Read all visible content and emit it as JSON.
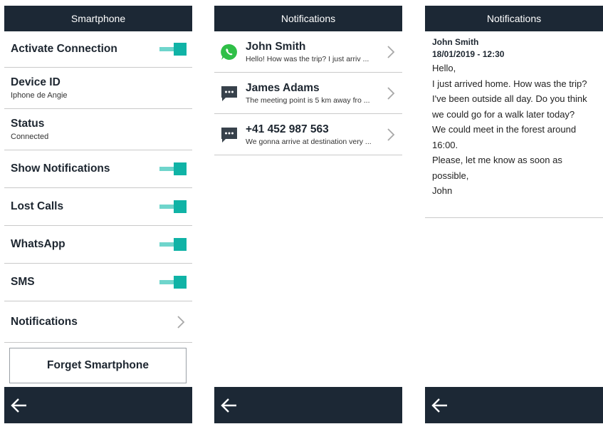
{
  "screen1": {
    "title": "Smartphone",
    "rows": [
      {
        "label": "Activate Connection",
        "control": "toggle",
        "on": true
      },
      {
        "label": "Device ID",
        "value": "Iphone de Angie"
      },
      {
        "label": "Status",
        "value": "Connected"
      },
      {
        "label": "Show Notifications",
        "control": "toggle",
        "on": true
      },
      {
        "label": "Lost Calls",
        "control": "toggle",
        "on": true
      },
      {
        "label": "WhatsApp",
        "control": "toggle",
        "on": true
      },
      {
        "label": "SMS",
        "control": "toggle",
        "on": true
      },
      {
        "label": "Notifications",
        "control": "chevron-right-icon"
      }
    ],
    "forget_button": "Forget Smartphone"
  },
  "screen2": {
    "title": "Notifications",
    "items": [
      {
        "icon": "whatsapp-icon",
        "name": "John Smith",
        "preview": "Hello! How was the trip? I just arriv ..."
      },
      {
        "icon": "sms-icon",
        "name": "James Adams",
        "preview": "The meeting point is 5 km away fro ..."
      },
      {
        "icon": "sms-icon",
        "name": "+41 452 987 563",
        "preview": "We gonna arrive at destination very ..."
      }
    ]
  },
  "screen3": {
    "title": "Notifications",
    "sender": "John Smith",
    "datetime": "18/01/2019 - 12:30",
    "body": "Hello,\nI just arrived home. How was the trip?\nI've been outside all day. Do you think\nwe could go for a walk later today?\nWe could meet in the forest around\n16:00.\nPlease, let me know as soon as\npossible,\nJohn"
  },
  "icons": {
    "back": "back-arrow-icon",
    "chevron": "chevron-right-icon"
  },
  "colors": {
    "header_bg": "#1c2835",
    "toggle_on": "#10b3a6",
    "toggle_track": "#6fd5cc",
    "whatsapp": "#2fbf47",
    "sms_icon": "#37414b"
  }
}
